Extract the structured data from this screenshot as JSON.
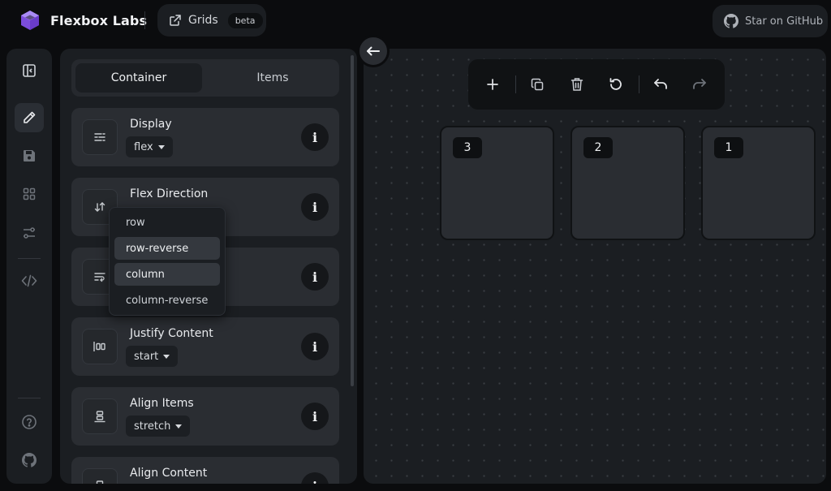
{
  "app": {
    "brand_name": "Flexbox Labs",
    "grids_label": "Grids",
    "beta_label": "beta",
    "github_label": "Star on GitHub"
  },
  "sidebar": {
    "items": [
      {
        "name": "toggle-panel",
        "icon": "panel-left-icon",
        "active": false
      },
      {
        "name": "edit",
        "icon": "pencil-icon",
        "active": true
      },
      {
        "name": "save",
        "icon": "floppy-disk-icon",
        "active": false
      },
      {
        "name": "layouts",
        "icon": "grid-icon",
        "active": false
      },
      {
        "name": "settings",
        "icon": "sliders-icon",
        "active": false
      },
      {
        "name": "code",
        "icon": "code-icon",
        "active": false
      },
      {
        "name": "help",
        "icon": "help-circle-icon",
        "active": false
      },
      {
        "name": "github",
        "icon": "github-icon",
        "active": false
      }
    ]
  },
  "panel": {
    "tabs": [
      {
        "label": "Container",
        "active": true
      },
      {
        "label": "Items",
        "active": false
      }
    ],
    "properties": [
      {
        "title": "Display",
        "value": "flex",
        "icon": "display-icon"
      },
      {
        "title": "Flex Direction",
        "value": "",
        "icon": "arrows-swap-icon"
      },
      {
        "title": "",
        "value": "",
        "icon": "wrap-text-icon"
      },
      {
        "title": "Justify Content",
        "value": "start",
        "icon": "justify-icon"
      },
      {
        "title": "Align Items",
        "value": "stretch",
        "icon": "align-items-icon"
      },
      {
        "title": "Align Content",
        "value": "",
        "icon": "align-content-icon"
      }
    ],
    "info_label": "i"
  },
  "dropdown": {
    "options": [
      "row",
      "row-reverse",
      "column",
      "column-reverse"
    ],
    "highlighted": [
      "row-reverse",
      "column"
    ]
  },
  "toolbar": {
    "tools": [
      "plus-icon",
      "copy-icon",
      "trash-icon",
      "reset-icon",
      "undo-icon",
      "redo-icon"
    ]
  },
  "canvas": {
    "items": [
      "3",
      "2",
      "1"
    ]
  },
  "colors": {
    "background": "#0b0c0e",
    "surface": "#1b1e22",
    "card": "#2a2d32",
    "accent_purple": "#8b5cf6"
  }
}
